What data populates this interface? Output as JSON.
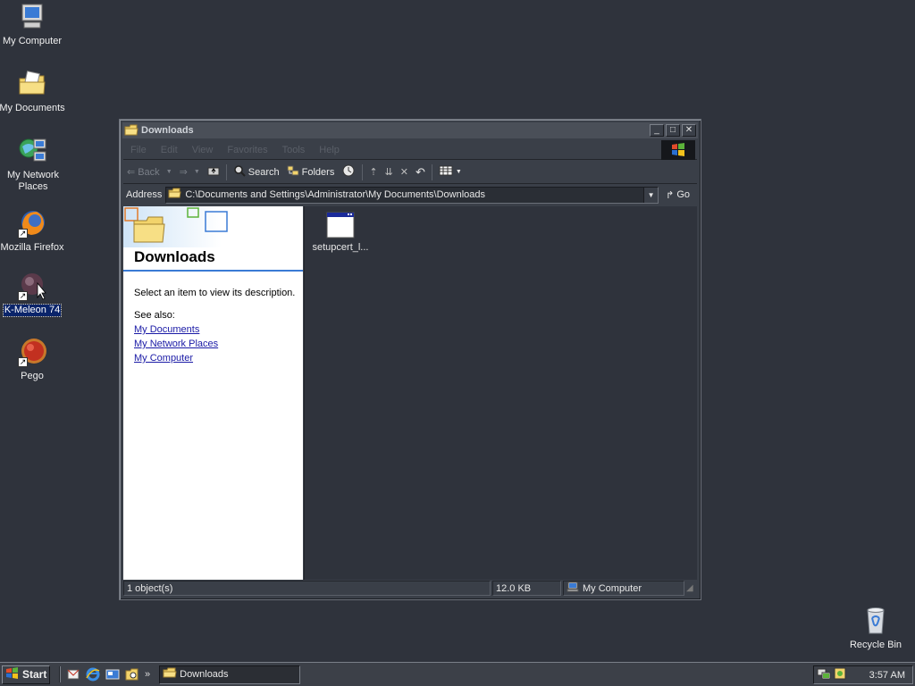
{
  "desktop": {
    "icons": [
      {
        "label": "My Computer"
      },
      {
        "label": "My Documents"
      },
      {
        "label": "My Network Places"
      },
      {
        "label": "Mozilla Firefox"
      },
      {
        "label": "K-Meleon 74"
      },
      {
        "label": "Pego"
      },
      {
        "label": "Recycle Bin"
      }
    ]
  },
  "window": {
    "title": "Downloads",
    "buttons": {
      "minimize": "_",
      "maximize": "□",
      "close": "✕"
    },
    "menu": [
      "File",
      "Edit",
      "View",
      "Favorites",
      "Tools",
      "Help"
    ],
    "toolbar": {
      "back": "Back",
      "search": "Search",
      "folders": "Folders"
    },
    "address": {
      "label": "Address",
      "path": "C:\\Documents and Settings\\Administrator\\My Documents\\Downloads",
      "go": "Go"
    },
    "left_pane": {
      "title": "Downloads",
      "description": "Select an item to view its description.",
      "see_also": "See also:",
      "links": [
        "My Documents",
        "My Network Places",
        "My Computer"
      ]
    },
    "files": [
      {
        "name": "setupcert_l..."
      }
    ],
    "status": {
      "objects": "1 object(s)",
      "size": "12.0 KB",
      "zone": "My Computer"
    }
  },
  "taskbar": {
    "start": "Start",
    "task": "Downloads",
    "clock": "3:57 AM"
  }
}
